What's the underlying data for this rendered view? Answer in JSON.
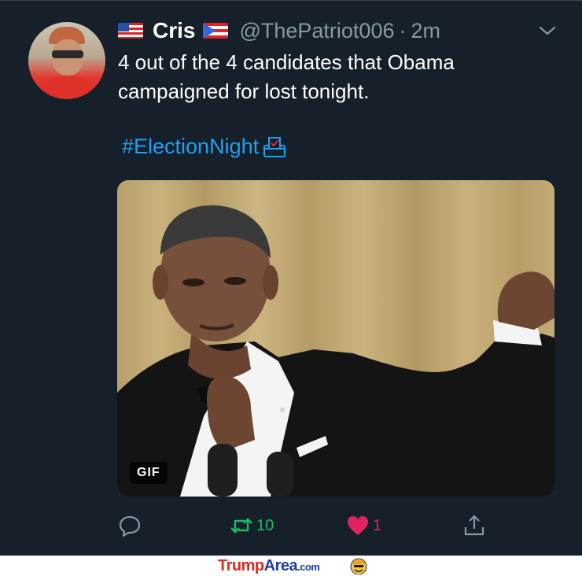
{
  "tweet": {
    "name": "Cris",
    "handle": "@ThePatriot006",
    "separator": "·",
    "time": "2m",
    "text": "4 out of the 4 candidates that Obama campaigned for lost tonight.",
    "hashtag": "#ElectionNight",
    "media_badge": "GIF",
    "flags": [
      "us-flag",
      "puerto-rico-flag"
    ]
  },
  "actions": {
    "reply_count": "",
    "retweet_count": "10",
    "like_count": "1",
    "icons": [
      "reply-icon",
      "retweet-icon",
      "heart-icon",
      "share-icon"
    ]
  },
  "colors": {
    "background": "#15202b",
    "text": "#ffffff",
    "muted": "#8899a6",
    "link": "#1da1f2",
    "retweet": "#17bf63",
    "like": "#e0245e"
  },
  "footer": {
    "brand_part1": "Trump",
    "brand_part2": "Area",
    "brand_part3": ".com"
  }
}
